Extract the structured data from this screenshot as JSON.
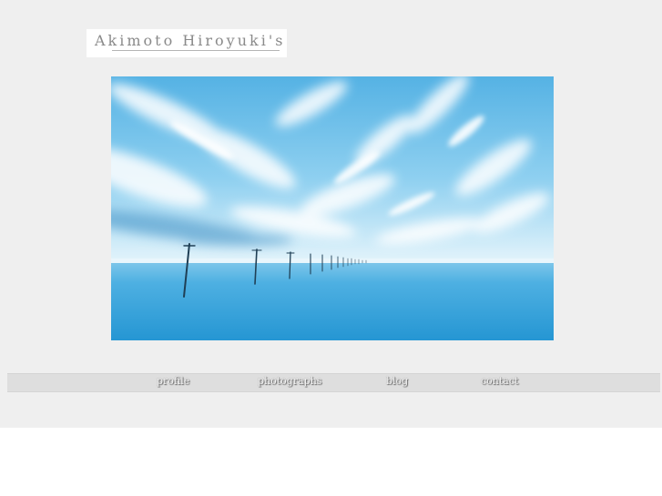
{
  "site": {
    "logo_text": "Akimoto Hiroyuki's"
  },
  "hero": {
    "icon": "seascape-photo",
    "colors": {
      "sky_top": "#5fb7e6",
      "horizon": "#dff1fa",
      "sea": "#3aa6dc",
      "sea_deep": "#1e8fce"
    }
  },
  "nav": {
    "items": [
      {
        "label": "profile"
      },
      {
        "label": "photographs"
      },
      {
        "label": "blog"
      },
      {
        "label": "contact"
      }
    ]
  }
}
